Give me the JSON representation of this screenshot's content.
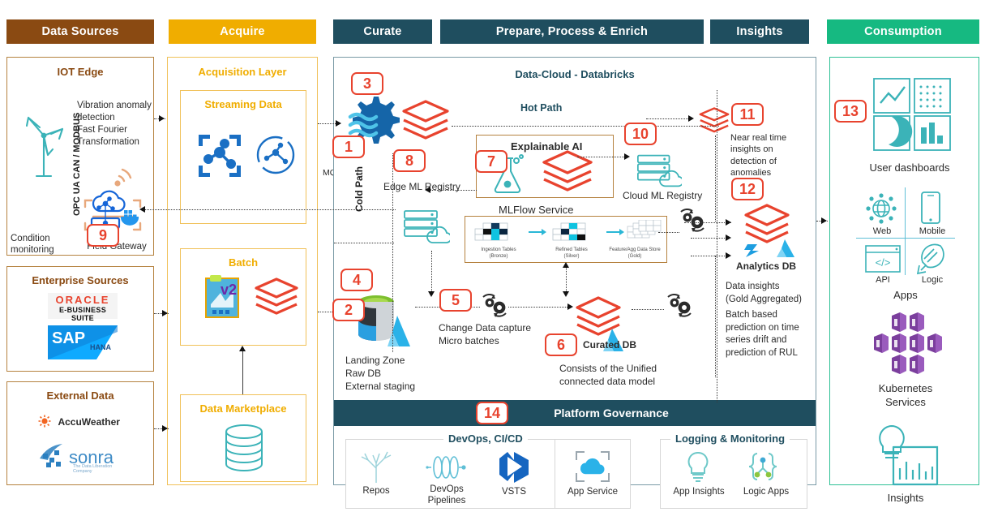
{
  "headers": [
    {
      "label": "Data Sources",
      "color": "#8a4a12"
    },
    {
      "label": "Acquire",
      "color": "#f0ad00"
    },
    {
      "label": "Curate",
      "color": "#1f4e5f"
    },
    {
      "label": "Prepare, Process & Enrich",
      "color": "#1f4e5f"
    },
    {
      "label": "Insights",
      "color": "#1f4e5f"
    },
    {
      "label": "Consumption",
      "color": "#16b981"
    }
  ],
  "data_sources": {
    "iot_edge": {
      "title": "IOT Edge",
      "protocol_label": "OPC UA CAN / MODBUS",
      "capabilities": "Vibration anomaly\ndetection\nFast Fourier\nTransformation",
      "turbine_caption": "Condition\nmonitoring",
      "gateway_caption": "Field Gateway",
      "badge": "9"
    },
    "enterprise": {
      "title": "Enterprise Sources",
      "logos": [
        {
          "name": "oracle-ebs-logo",
          "line1": "ORACLE",
          "line2": "E-BUSINESS SUITE"
        },
        {
          "name": "sap-hana-logo",
          "line1": "SAP",
          "line2": "HANA"
        }
      ]
    },
    "external": {
      "title": "External Data",
      "logos": [
        {
          "name": "accuweather-logo",
          "line1": "AccuWeather"
        },
        {
          "name": "sonra-logo",
          "line1": "sonra",
          "line2": "The Data Liberation Company"
        }
      ]
    }
  },
  "acquire": {
    "title": "Acquisition Layer",
    "streaming": {
      "title": "Streaming Data",
      "badge": "1",
      "protocol": "MQTTS"
    },
    "batch": {
      "title": "Batch",
      "badge": "2"
    },
    "marketplace": {
      "title": "Data Marketplace"
    }
  },
  "platform": {
    "title": "Data-Cloud - Databricks",
    "hot_path": "Hot Path",
    "cold_path": "Cold Path",
    "ingest_badge": "3",
    "edge_ml_registry": {
      "badge": "8",
      "label": "Edge ML Registry"
    },
    "mlflow": {
      "badge": "7",
      "title": "Explainable AI",
      "caption": "MLFlow Service"
    },
    "cloud_ml_registry": {
      "badge": "10",
      "label": "Cloud ML Registry"
    },
    "medallion": [
      {
        "line1": "Ingestion Tables",
        "line2": "(Bronze)"
      },
      {
        "line1": "Refined Tables",
        "line2": "(Silver)"
      },
      {
        "line1": "Feature/Agg Data Store",
        "line2": "(Gold)"
      }
    ],
    "landing_zone": {
      "badge": "4",
      "caption": "Landing Zone\nRaw DB\nExternal staging"
    },
    "cdc": {
      "badge": "5",
      "caption": "Change Data capture\nMicro batches"
    },
    "curated_db": {
      "badge": "6",
      "label": "Curated DB",
      "caption": "Consists of the Unified\nconnected data model"
    }
  },
  "insights": {
    "near_real_time": {
      "badge": "11",
      "text": "Near real time\ninsights on\ndetection of\nanomalies"
    },
    "analytics_db": {
      "badge": "12",
      "label": "Analytics DB"
    },
    "notes": "Data insights\n(Gold Aggregated)",
    "notes2": "Batch based\nprediction on time\nseries drift and\nprediction of RUL"
  },
  "consumption": {
    "badge": "13",
    "dashboards_caption": "User dashboards",
    "apps_caption": "Apps",
    "app_tiles": [
      {
        "name": "web-icon",
        "label": "Web"
      },
      {
        "name": "mobile-icon",
        "label": "Mobile"
      },
      {
        "name": "api-icon",
        "label": "API"
      },
      {
        "name": "logic-icon",
        "label": "Logic"
      }
    ],
    "kubernetes_caption": "Kubernetes\nServices",
    "insights_caption": "Insights"
  },
  "governance": {
    "badge": "14",
    "title": "Platform Governance",
    "devops": {
      "title": "DevOps, CI/CD",
      "items": [
        {
          "name": "repos-icon",
          "label": "Repos"
        },
        {
          "name": "devops-pipelines-icon",
          "label": "DevOps\nPipelines"
        },
        {
          "name": "vsts-icon",
          "label": "VSTS"
        },
        {
          "name": "app-service-icon",
          "label": "App Service"
        }
      ]
    },
    "logging": {
      "title": "Logging & Monitoring",
      "items": [
        {
          "name": "app-insights-icon",
          "label": "App Insights"
        },
        {
          "name": "logic-apps-icon",
          "label": "Logic Apps"
        }
      ]
    }
  }
}
